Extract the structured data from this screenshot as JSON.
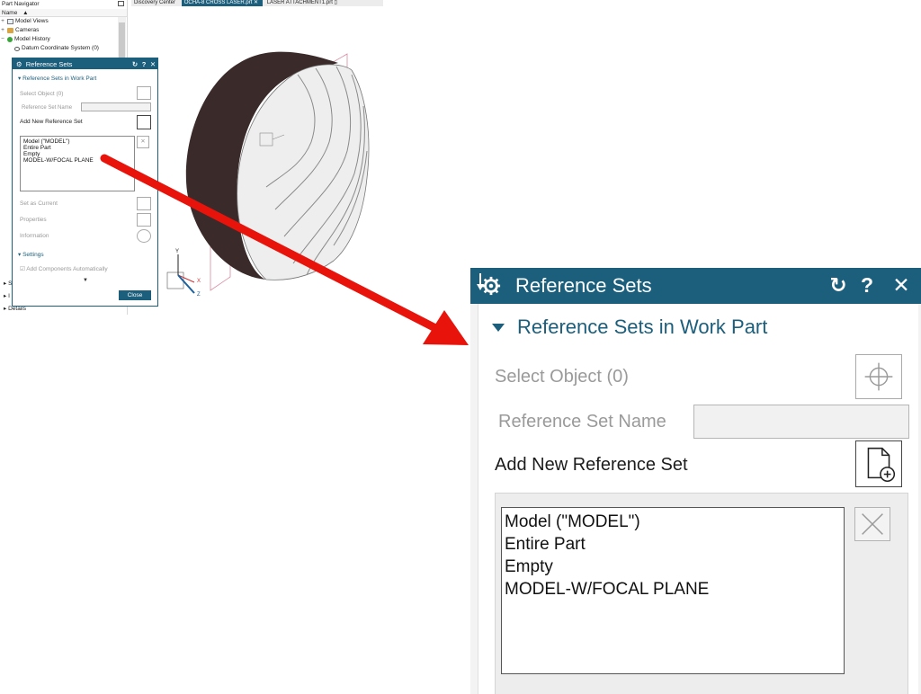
{
  "navigator": {
    "title": "Part Navigator",
    "column_header": "Name",
    "items": [
      {
        "label": "Model Views"
      },
      {
        "label": "Cameras"
      },
      {
        "label": "Model History"
      },
      {
        "label": "Datum Coordinate System (0)"
      }
    ],
    "bottom_rows": [
      "S",
      "I",
      "Details"
    ]
  },
  "tabs": [
    {
      "label": "Discovery Center"
    },
    {
      "label": "OCHA-8 CROSS LASER.prt"
    },
    {
      "label": "LASER ATTACHMENT1.prt"
    }
  ],
  "small_dialog": {
    "title": "Reference Sets",
    "section": "Reference Sets in Work Part",
    "select_object": "Select Object (0)",
    "ref_set_name": "Reference Set Name",
    "add_new": "Add New Reference Set",
    "list": [
      "Model (\"MODEL\")",
      "Entire Part",
      "Empty",
      "MODEL-W/FOCAL PLANE"
    ],
    "set_as_current": "Set as Current",
    "properties": "Properties",
    "information": "Information",
    "settings": "Settings",
    "add_components": "Add Components Automatically",
    "close": "Close"
  },
  "viewport": {
    "axis_x": "X",
    "axis_y": "Y",
    "axis_z": "Z"
  },
  "zoom_dialog": {
    "title": "Reference Sets",
    "section": "Reference Sets in Work Part",
    "select_object": "Select Object (0)",
    "ref_set_name": "Reference Set Name",
    "ref_set_name_value": "",
    "add_new": "Add New Reference Set",
    "list": [
      "Model (\"MODEL\")",
      "Entire Part",
      "Empty",
      "MODEL-W/FOCAL PLANE"
    ],
    "buttons": {
      "reset": "↻",
      "help": "?",
      "close": "✕"
    }
  },
  "colors": {
    "title_bar": "#1b5f7d",
    "arrow": "#e8140c",
    "accent_text": "#1b5f7d"
  }
}
